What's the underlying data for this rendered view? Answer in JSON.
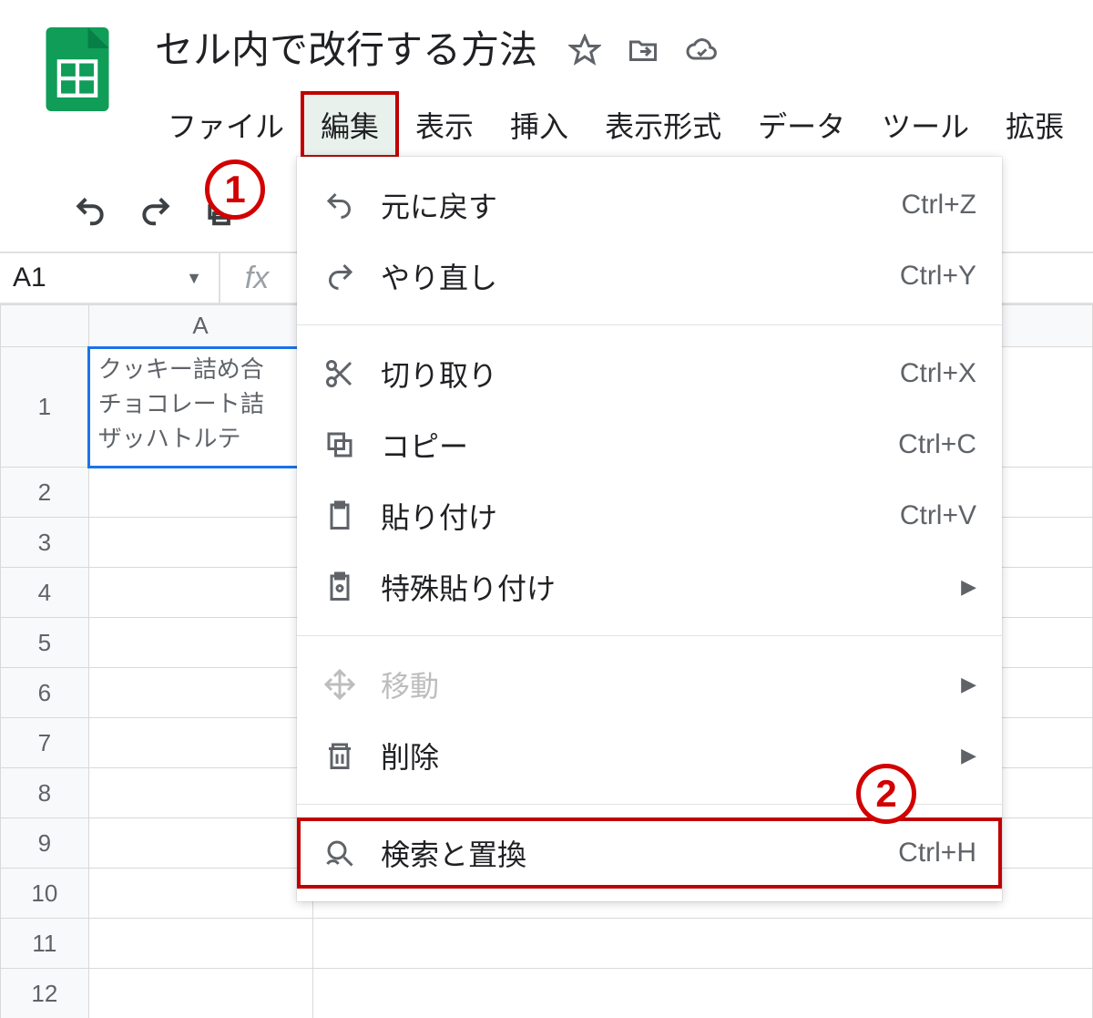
{
  "doc": {
    "title": "セル内で改行する方法"
  },
  "menubar": {
    "file": "ファイル",
    "edit": "編集",
    "view": "表示",
    "insert": "挿入",
    "format": "表示形式",
    "data": "データ",
    "tools": "ツール",
    "extensions": "拡張"
  },
  "name_box": {
    "ref": "A1"
  },
  "columns": {
    "a": "A"
  },
  "rows": [
    "1",
    "2",
    "3",
    "4",
    "5",
    "6",
    "7",
    "8",
    "9",
    "10",
    "11",
    "12"
  ],
  "cells": {
    "a1_line1": "クッキー詰め合",
    "a1_line2": "チョコレート詰",
    "a1_line3": "ザッハトルテ"
  },
  "edit_menu": {
    "undo": {
      "label": "元に戻す",
      "shortcut": "Ctrl+Z"
    },
    "redo": {
      "label": "やり直し",
      "shortcut": "Ctrl+Y"
    },
    "cut": {
      "label": "切り取り",
      "shortcut": "Ctrl+X"
    },
    "copy": {
      "label": "コピー",
      "shortcut": "Ctrl+C"
    },
    "paste": {
      "label": "貼り付け",
      "shortcut": "Ctrl+V"
    },
    "paste_special": {
      "label": "特殊貼り付け"
    },
    "move": {
      "label": "移動"
    },
    "delete": {
      "label": "削除"
    },
    "find_replace": {
      "label": "検索と置換",
      "shortcut": "Ctrl+H"
    }
  },
  "annotations": {
    "step1": "1",
    "step2": "2"
  },
  "glyphs": {
    "submenu": "▶",
    "caret": "▼"
  }
}
